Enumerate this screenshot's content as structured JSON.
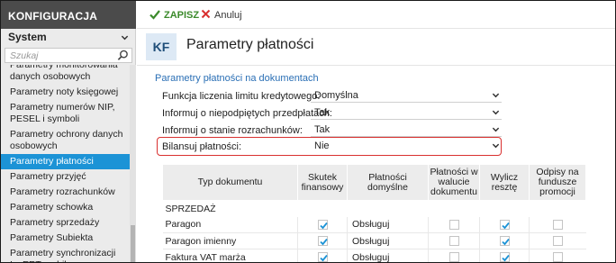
{
  "sidebar": {
    "header": "KONFIGURACJA",
    "module": "System",
    "search_placeholder": "Szukaj",
    "items": [
      {
        "label": "Parametry monitorowania danych osobowych",
        "active": false
      },
      {
        "label": "Parametry noty księgowej",
        "active": false
      },
      {
        "label": "Parametry numerów NIP, PESEL i symboli",
        "active": false
      },
      {
        "label": "Parametry ochrony danych osobowych",
        "active": false
      },
      {
        "label": "Parametry płatności",
        "active": true
      },
      {
        "label": "Parametry przyjęć",
        "active": false
      },
      {
        "label": "Parametry rozrachunków",
        "active": false
      },
      {
        "label": "Parametry schowka",
        "active": false
      },
      {
        "label": "Parametry sprzedaży",
        "active": false
      },
      {
        "label": "Parametry Subiekta",
        "active": false
      },
      {
        "label": "Parametry synchronizacji InsERT mobile",
        "active": false
      }
    ]
  },
  "toolbar": {
    "save_label": "ZAPISZ",
    "cancel_label": "Anuluj"
  },
  "header": {
    "badge": "KF",
    "title": "Parametry płatności"
  },
  "section": {
    "title": "Parametry płatności na dokumentach"
  },
  "form": {
    "rows": [
      {
        "label": "Funkcja liczenia limitu kredytowego:",
        "value": "Domyślna"
      },
      {
        "label": "Informuj o niepodpiętych przedpłatach:",
        "value": "Tak"
      },
      {
        "label": "Informuj o stanie rozrachunków:",
        "value": "Tak"
      },
      {
        "label": "Bilansuj płatności:",
        "value": "Nie"
      }
    ]
  },
  "table": {
    "columns": [
      "Typ dokumentu",
      "Skutek finansowy",
      "Płatności domyślne",
      "Płatności w walucie dokumentu",
      "Wylicz resztę",
      "Odpisy na fundusze promocji"
    ],
    "group": "SPRZEDAŻ",
    "rows": [
      {
        "type": "Paragon",
        "skutek": true,
        "platnosci": "Obsługuj",
        "waluta": false,
        "reszta": true,
        "odpisy": false
      },
      {
        "type": "Paragon imienny",
        "skutek": true,
        "platnosci": "Obsługuj",
        "waluta": false,
        "reszta": true,
        "odpisy": false
      },
      {
        "type": "Faktura VAT marża",
        "skutek": true,
        "platnosci": "Obsługuj",
        "waluta": false,
        "reszta": true,
        "odpisy": false
      }
    ]
  },
  "colors": {
    "accent": "#1c93d6",
    "save_green": "#3b8a2b",
    "cancel_red": "#d9302f",
    "header_dark": "#4b4b4b"
  }
}
